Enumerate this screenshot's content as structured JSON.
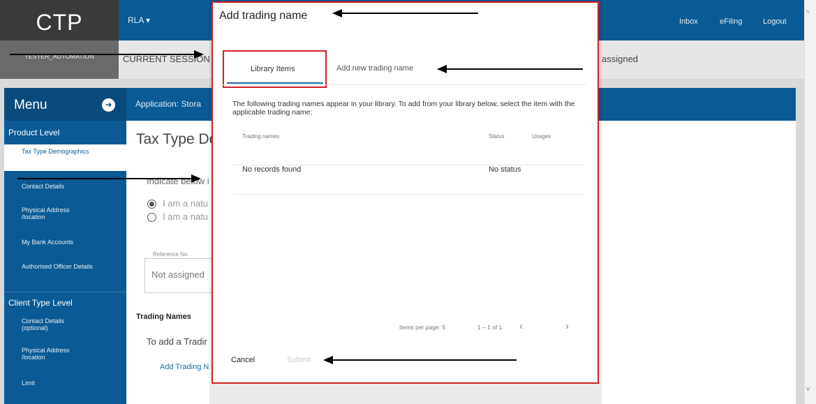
{
  "header": {
    "logo": "CTP",
    "menu_label": "RLA",
    "menu_caret": "▾",
    "nav": [
      "Inbox",
      "eFiling",
      "Logout"
    ]
  },
  "session": {
    "username": "TESTER_AUTOMATION",
    "label": "CURRENT SESSION",
    "assigned": "assigned"
  },
  "sidebar": {
    "title": "Menu",
    "icon": "compass-icon",
    "sections": [
      {
        "heading": "Product Level",
        "items": [
          "Tax Type Demographics",
          "Contact Details",
          "Physical Address /location",
          "My Bank Accounts",
          "Authorised Officer Details"
        ]
      },
      {
        "heading": "Client Type Level",
        "items": [
          "Contact Details (optional)",
          "Physical Address /location",
          "Limit"
        ]
      }
    ],
    "active_item": "Tax Type Demographics"
  },
  "main": {
    "app_label": "Application: Stora",
    "page_title": "Tax Type De",
    "indicate_text": "Indicate below i",
    "radio1": "I am a natu",
    "radio2": "I am a natu",
    "reference_label": "Reference No.",
    "reference_value": "Not assigned",
    "trading_heading": "Trading Names",
    "to_add_text": "To add a Tradir",
    "add_link": "Add Trading N"
  },
  "dialog": {
    "title": "Add trading name",
    "tabs": [
      "Library Items",
      "Add new trading name"
    ],
    "active_tab": "Library Items",
    "intro": "The following trading names appear in your library. To add from your library below, select the item with the applicable trading name:",
    "columns": [
      "Trading names",
      "Status",
      "Usages"
    ],
    "rows": [
      {
        "name": "No records found",
        "status": "No status",
        "usages": ""
      }
    ],
    "pagination": {
      "items_per_page": "Items per page: 5",
      "range": "1 – 1 of 1",
      "prev": "‹",
      "next": "›"
    },
    "cancel": "Cancel",
    "submit": "Submit"
  },
  "colors": {
    "brand": "#0a5a95",
    "highlight": "#d41f26",
    "link": "#1a6aa8"
  }
}
